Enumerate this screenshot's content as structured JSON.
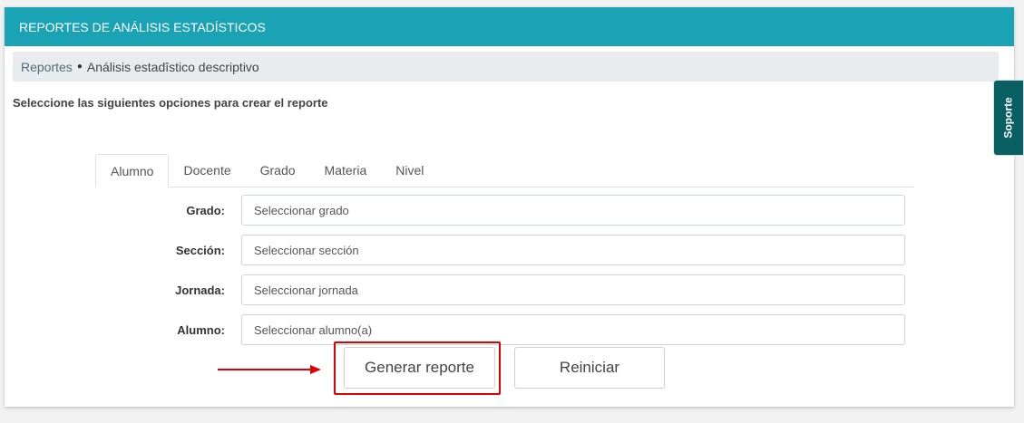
{
  "header": {
    "title": "REPORTES DE ANÁLISIS ESTADÍSTICOS"
  },
  "breadcrumb": {
    "link": "Reportes",
    "separator": "●",
    "current": "Análisis estadîstico descriptivo"
  },
  "instructions": "Seleccione las siguientes opciones para crear el reporte",
  "tabs": [
    {
      "label": "Alumno",
      "active": true
    },
    {
      "label": "Docente",
      "active": false
    },
    {
      "label": "Grado",
      "active": false
    },
    {
      "label": "Materia",
      "active": false
    },
    {
      "label": "Nivel",
      "active": false
    }
  ],
  "form": {
    "fields": [
      {
        "label": "Grado:",
        "placeholder": "Seleccionar grado"
      },
      {
        "label": "Sección:",
        "placeholder": "Seleccionar sección"
      },
      {
        "label": "Jornada:",
        "placeholder": "Seleccionar jornada"
      },
      {
        "label": "Alumno:",
        "placeholder": "Seleccionar alumno(a)"
      }
    ]
  },
  "buttons": {
    "generate": "Generar reporte",
    "reset": "Reiniciar"
  },
  "support": {
    "label": "Soporte"
  },
  "colors": {
    "header": "#1aa3b5",
    "support": "#0a5f62",
    "annotation": "#e00000"
  }
}
